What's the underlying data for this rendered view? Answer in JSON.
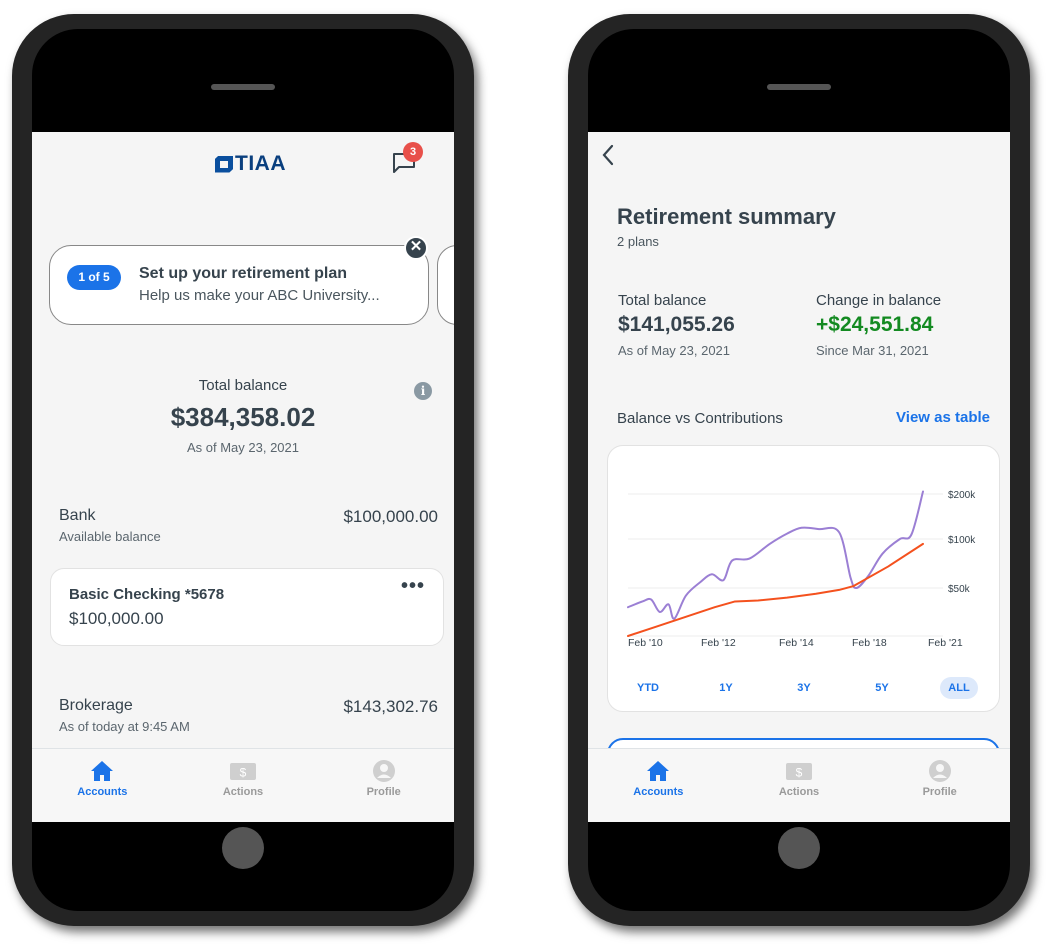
{
  "left_screen": {
    "logo_text": "TIAA",
    "messages_badge": "3",
    "promo": {
      "step": "1 of 5",
      "title": "Set up your retirement plan",
      "subtitle": "Help us make your ABC University..."
    },
    "total": {
      "label": "Total balance",
      "value": "$384,358.02",
      "date": "As of May 23, 2021"
    },
    "accounts": [
      {
        "name": "Bank",
        "subtitle": "Available balance",
        "amount": "$100,000.00",
        "items": [
          {
            "name": "Basic Checking *5678",
            "amount": "$100,000.00"
          }
        ]
      },
      {
        "name": "Brokerage",
        "subtitle": "As of today at 9:45 AM",
        "amount": "$143,302.76"
      }
    ]
  },
  "right_screen": {
    "title": "Retirement summary",
    "subtitle": "2 plans",
    "total_balance": {
      "label": "Total balance",
      "value": "$141,055.26",
      "date": "As of May 23, 2021"
    },
    "change": {
      "label": "Change in balance",
      "value": "+$24,551.84",
      "date": "Since Mar 31, 2021"
    },
    "section_label": "Balance vs Contributions",
    "view_table_link": "View as table",
    "ranges": [
      "YTD",
      "1Y",
      "3Y",
      "5Y",
      "ALL"
    ],
    "active_range": "ALL"
  },
  "tabbar": {
    "tabs": [
      {
        "label": "Accounts",
        "icon": "home-icon",
        "active": true
      },
      {
        "label": "Actions",
        "icon": "dollar-icon",
        "active": false
      },
      {
        "label": "Profile",
        "icon": "profile-icon",
        "active": false
      }
    ]
  },
  "colors": {
    "accent": "#1b73e8",
    "positive": "#138a21",
    "badge": "#e8504a",
    "balance_line": "#9b7fd4",
    "contributions_line": "#f4511e"
  },
  "chart_data": {
    "type": "line",
    "title": "Balance vs Contributions",
    "x_tick_labels": [
      "Feb '10",
      "Feb '12",
      "Feb '14",
      "Feb '18",
      "Feb '21"
    ],
    "y_tick_labels": [
      "$50k",
      "$100k",
      "$200k"
    ],
    "y_ticks": [
      50000,
      100000,
      200000
    ],
    "grid": true,
    "series": [
      {
        "name": "Balance",
        "x": [
          2010.0,
          2010.5,
          2010.8,
          2011.1,
          2011.4,
          2011.6,
          2012.0,
          2012.5,
          2012.9,
          2013.3,
          2013.6,
          2014.2,
          2014.9,
          2015.5,
          2016.0,
          2016.6,
          2017.3,
          2017.7,
          2017.9,
          2018.3,
          2018.8,
          2019.4,
          2019.8,
          2020.2
        ],
        "values": [
          30000,
          36000,
          38000,
          25000,
          33000,
          18000,
          42000,
          56000,
          64000,
          58000,
          78000,
          80000,
          95000,
          112000,
          125000,
          122000,
          115000,
          60000,
          50000,
          62000,
          85000,
          100000,
          110000,
          205000
        ]
      },
      {
        "name": "Contributions",
        "x": [
          2010.0,
          2011.0,
          2012.0,
          2013.0,
          2013.7,
          2014.5,
          2015.5,
          2016.5,
          2017.3,
          2017.8,
          2019.0,
          2020.2
        ],
        "values": [
          0,
          10000,
          20000,
          30000,
          36000,
          37000,
          40000,
          44000,
          48000,
          52000,
          72000,
          95000
        ]
      }
    ]
  }
}
